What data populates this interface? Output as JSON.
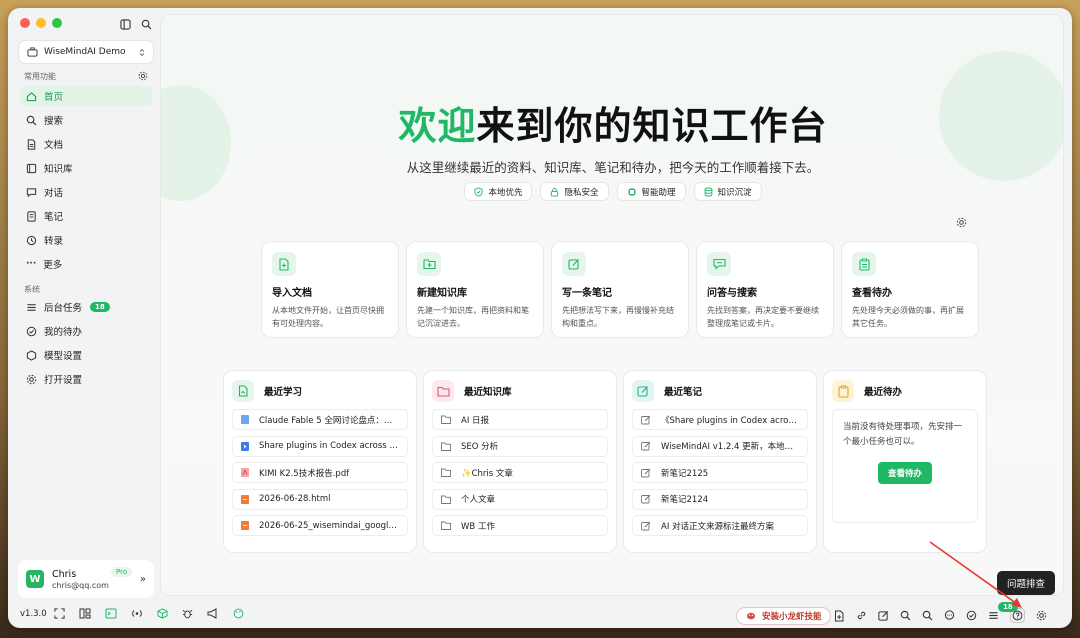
{
  "workspace": {
    "name": "WiseMindAI Demo"
  },
  "sidebar": {
    "common_label": "常用功能",
    "system_label": "系统",
    "items": [
      {
        "label": "首页",
        "icon": "home-icon",
        "active": true
      },
      {
        "label": "搜索",
        "icon": "search-icon"
      },
      {
        "label": "文档",
        "icon": "document-icon"
      },
      {
        "label": "知识库",
        "icon": "knowledge-base-icon"
      },
      {
        "label": "对话",
        "icon": "chat-icon"
      },
      {
        "label": "笔记",
        "icon": "notebook-icon"
      },
      {
        "label": "转录",
        "icon": "transcribe-icon"
      },
      {
        "label": "更多",
        "icon": "more-icon"
      }
    ],
    "system_items": [
      {
        "label": "后台任务",
        "icon": "tasks-icon",
        "badge": "18"
      },
      {
        "label": "我的待办",
        "icon": "todo-check-icon"
      },
      {
        "label": "模型设置",
        "icon": "model-settings-icon"
      },
      {
        "label": "打开设置",
        "icon": "settings-icon"
      }
    ]
  },
  "user": {
    "name": "Chris",
    "email": "chris@qq.com",
    "plan": "Pro",
    "avatar_letter": "W"
  },
  "hero": {
    "title_highlight": "欢迎",
    "title_rest": "来到你的知识工作台",
    "subtitle": "从这里继续最近的资料、知识库、笔记和待办，把今天的工作顺着接下去。",
    "chips": [
      "本地优先",
      "隐私安全",
      "智能助理",
      "知识沉淀"
    ]
  },
  "actions": [
    {
      "title": "导入文档",
      "desc": "从本地文件开始，让首页尽快拥有可处理内容。"
    },
    {
      "title": "新建知识库",
      "desc": "先建一个知识库，再把资料和笔记沉淀进去。"
    },
    {
      "title": "写一条笔记",
      "desc": "先把想法写下来，再慢慢补充结构和重点。"
    },
    {
      "title": "问答与搜索",
      "desc": "先找到答案，再决定要不要继续整理成笔记或卡片。"
    },
    {
      "title": "查看待办",
      "desc": "先处理今天必须做的事，再扩展其它任务。"
    }
  ],
  "recent_learning": {
    "title": "最近学习",
    "items": [
      "Claude Fable 5 全网讨论盘点：从封…",
      "Share plugins in Codex across tea…",
      "KIMI K2.5技术报告.pdf",
      "2026-06-28.html",
      "2026-06-25_wisemindai_google_…"
    ]
  },
  "recent_kb": {
    "title": "最近知识库",
    "items": [
      "AI 日报",
      "SEO 分析",
      "✨Chris 文章",
      "个人文章",
      "WB 工作"
    ]
  },
  "recent_notes": {
    "title": "最近笔记",
    "items": [
      "《Share plugins in Codex across…",
      "WiseMindAI v1.2.4 更新，本地文…",
      "新笔记2125",
      "新笔记2124",
      "AI 对话正文来源标注最终方案"
    ]
  },
  "recent_todo": {
    "title": "最近待办",
    "empty_text": "当前没有待处理事项，先安排一个最小任务也可以。",
    "button": "查看待办"
  },
  "bottombar": {
    "version": "v1.3.0",
    "skill_button": "安装小龙虾技能",
    "badge": "18",
    "tooltip": "问题排查"
  },
  "colors": {
    "accent": "#1fb864",
    "badge": "#1fb864",
    "danger": "#c0392b"
  }
}
